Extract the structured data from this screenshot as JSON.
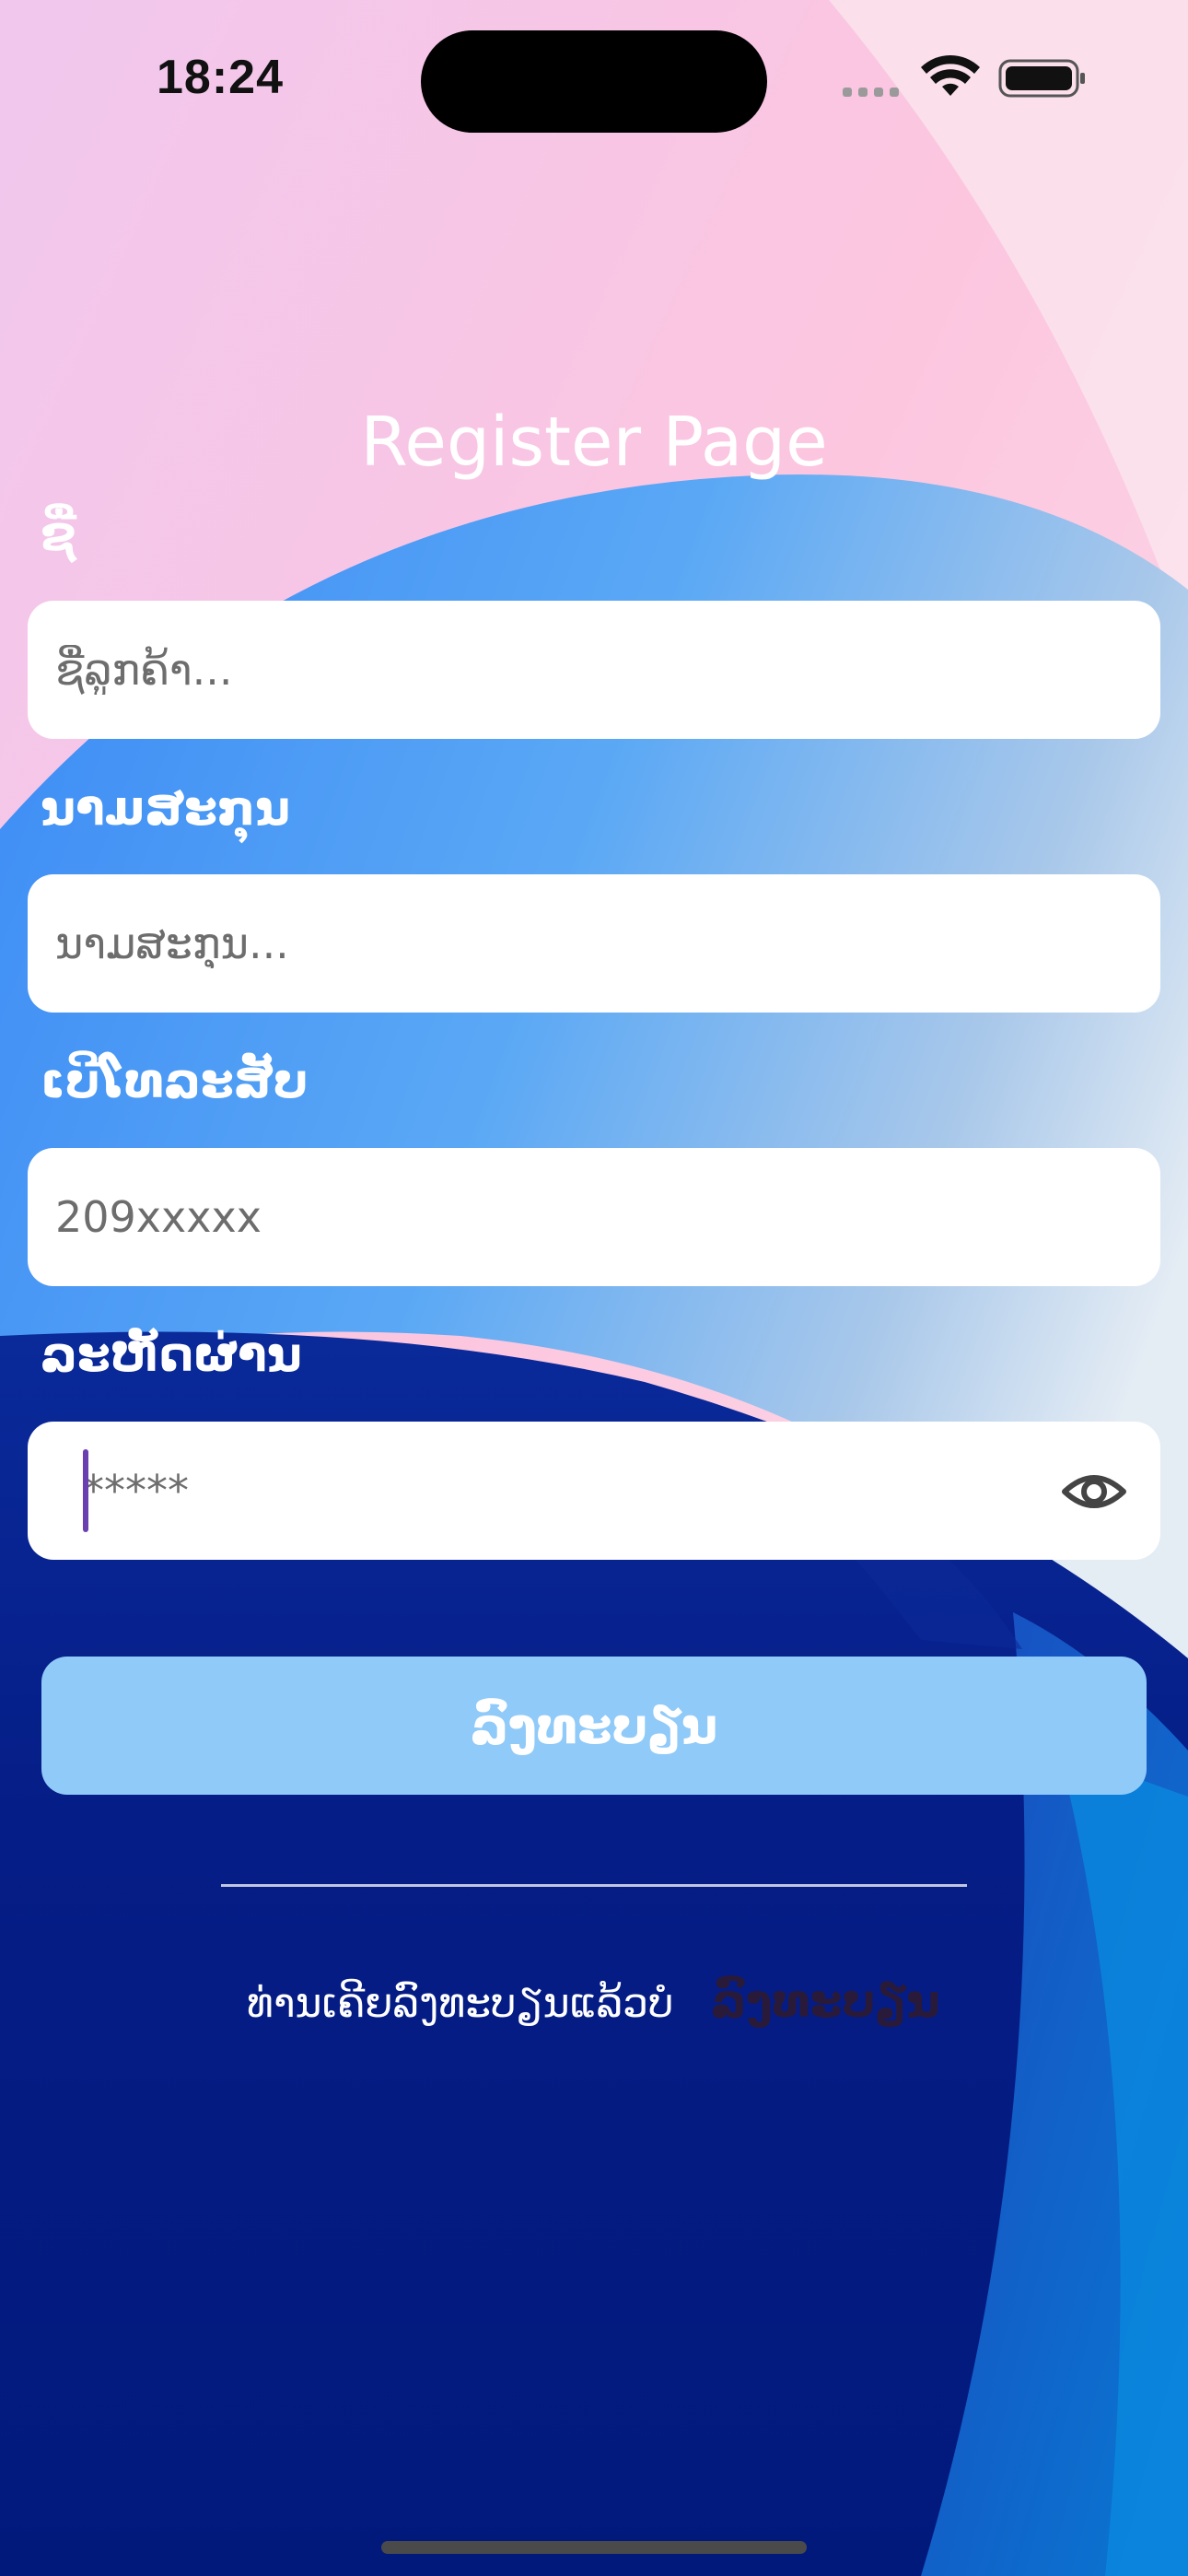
{
  "status_bar": {
    "time": "18:24"
  },
  "page": {
    "title": "Register Page"
  },
  "form": {
    "name": {
      "label": "ຊື່",
      "placeholder": "ຊື່ລູກຄ້າ...",
      "value": ""
    },
    "surname": {
      "label": "ນາມສະກຸນ",
      "placeholder": "ນາມສະກຸນ...",
      "value": ""
    },
    "phone": {
      "label": "ເບີໂທລະສັບ",
      "placeholder": "209xxxxx",
      "value": ""
    },
    "password": {
      "label": "ລະຫັດຜ່ານ",
      "placeholder": "*****",
      "value": "",
      "visibility_icon": "eye-icon"
    },
    "submit_label": "ລົງທະບຽນ"
  },
  "footer": {
    "question": "ທ່ານເຄີຍລົງທະບຽນແລ້ວບໍ",
    "link_label": "ລົງທະບຽນ"
  },
  "colors": {
    "button_bg": "#90caf9",
    "input_bg": "#ffffff",
    "link": "#2a1a3a",
    "caret": "#6a3fb0"
  }
}
